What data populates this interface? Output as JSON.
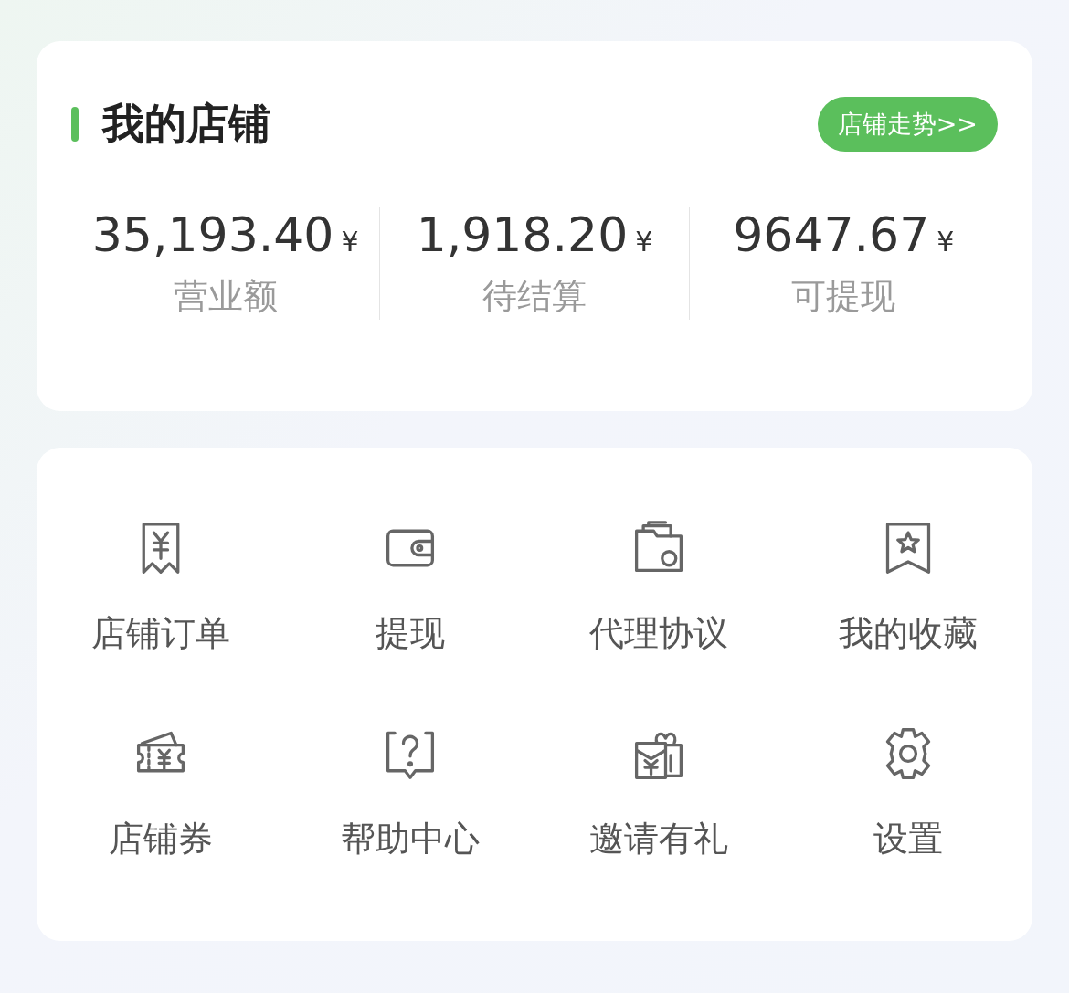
{
  "shop": {
    "title": "我的店铺",
    "trend_button": "店铺走势>>",
    "stats": [
      {
        "value": "35,193.40",
        "currency": "¥",
        "label": "营业额"
      },
      {
        "value": "1,918.20",
        "currency": "¥",
        "label": "待结算"
      },
      {
        "value": "9647.67",
        "currency": "¥",
        "label": "可提现"
      }
    ]
  },
  "menu": [
    {
      "label": "店铺订单"
    },
    {
      "label": "提现"
    },
    {
      "label": "代理协议"
    },
    {
      "label": "我的收藏"
    },
    {
      "label": "店铺券"
    },
    {
      "label": "帮助中心"
    },
    {
      "label": "邀请有礼"
    },
    {
      "label": "设置"
    }
  ]
}
